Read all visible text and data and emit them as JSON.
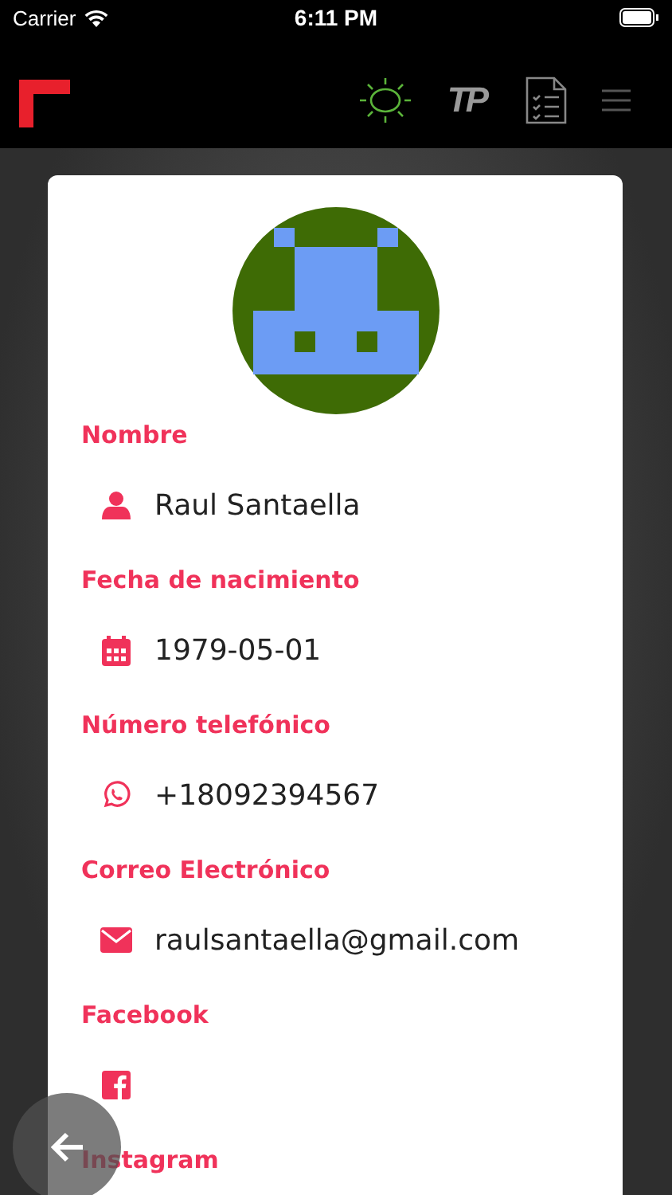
{
  "status_bar": {
    "carrier": "Carrier",
    "time": "6:11 PM"
  },
  "header": {
    "tp_logo": "TP"
  },
  "fields": [
    {
      "kind": "person",
      "label": "Nombre",
      "value": "Raul Santaella"
    },
    {
      "kind": "calendar",
      "label": "Fecha de nacimiento",
      "value": "1979-05-01"
    },
    {
      "kind": "whatsapp",
      "label": "Número telefónico",
      "value": "+18092394567"
    },
    {
      "kind": "mail",
      "label": "Correo Electrónico",
      "value": "raulsantaella@gmail.com"
    },
    {
      "kind": "facebook",
      "label": "Facebook"
    },
    {
      "kind": "instagram",
      "label": "Instagram"
    }
  ]
}
